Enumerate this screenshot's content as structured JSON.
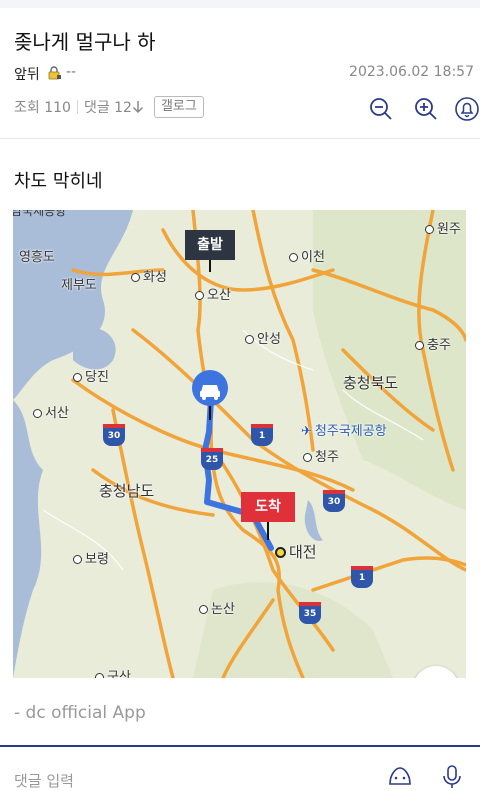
{
  "post": {
    "title": "좆나게 멀구나 하",
    "author": "앞뒤",
    "author_suffix": "--",
    "date": "2023.06.02 18:57",
    "views_label": "조회 110",
    "comments_label": "댓글 12",
    "gallery_button": "갤로그",
    "body": "차도 막히네",
    "signature": "- dc official App"
  },
  "map": {
    "places": [
      "원주",
      "이천",
      "화성",
      "오산",
      "안성",
      "충주",
      "당진",
      "충청북도",
      "서산",
      "청주국제공항",
      "청주",
      "충청남도",
      "보령",
      "대전",
      "논산",
      "군산",
      "제부도",
      "영흥도"
    ],
    "highways": [
      "30",
      "1",
      "25",
      "30",
      "1",
      "35"
    ],
    "start_label": "출발",
    "end_label": "도착",
    "partial_label_top": "남국제공항"
  },
  "comment_bar": {
    "placeholder": "댓글 입력"
  },
  "colors": {
    "route": "#3d74e0",
    "start_marker": "#2d3442",
    "end_marker": "#e0303a",
    "road": "#f0a43a",
    "bottom_border": "#2b3a8a"
  }
}
